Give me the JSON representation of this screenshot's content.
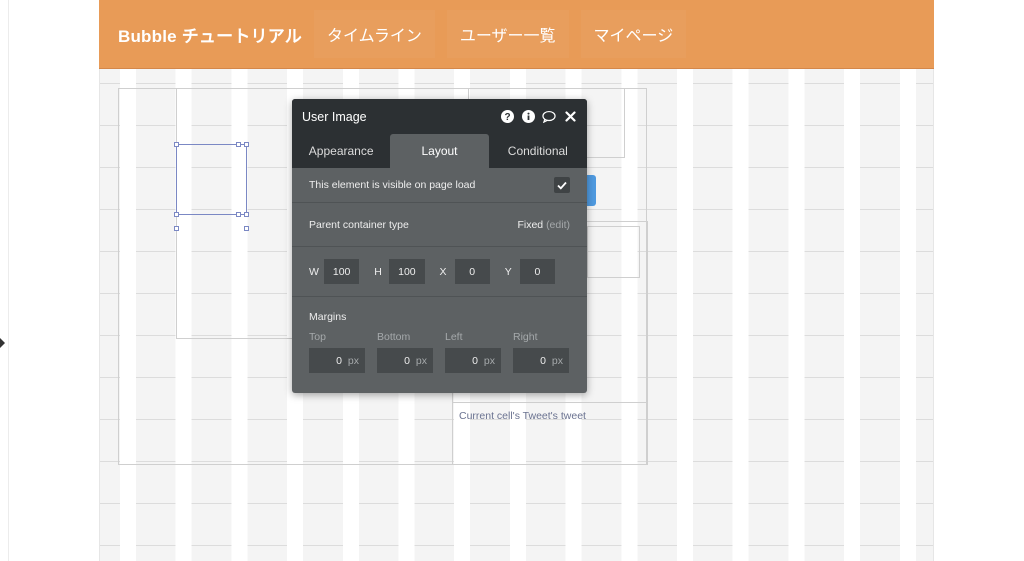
{
  "header": {
    "brand": "Bubble チュートリアル",
    "nav": [
      "タイムライン",
      "ユーザー一覧",
      "マイページ"
    ],
    "color": "#e89b57"
  },
  "canvas": {
    "cell_text": "Current cell's Tweet's tweet",
    "accent": "#4f9ae0"
  },
  "panel": {
    "title": "User Image",
    "title_icons": [
      "help-icon",
      "info-icon",
      "comment-icon",
      "close-icon"
    ],
    "tabs": [
      {
        "label": "Appearance",
        "active": false
      },
      {
        "label": "Layout",
        "active": true
      },
      {
        "label": "Conditional",
        "active": false
      }
    ],
    "visible_label": "This element is visible on page load",
    "visible_checked": true,
    "container_label": "Parent container type",
    "container_value": "Fixed",
    "container_edit": "(edit)",
    "dims": [
      {
        "label": "W",
        "value": "100"
      },
      {
        "label": "H",
        "value": "100"
      },
      {
        "label": "X",
        "value": "0"
      },
      {
        "label": "Y",
        "value": "0"
      }
    ],
    "margins_title": "Margins",
    "margins": [
      {
        "label": "Top",
        "value": "0",
        "unit": "px"
      },
      {
        "label": "Bottom",
        "value": "0",
        "unit": "px"
      },
      {
        "label": "Left",
        "value": "0",
        "unit": "px"
      },
      {
        "label": "Right",
        "value": "0",
        "unit": "px"
      }
    ]
  }
}
